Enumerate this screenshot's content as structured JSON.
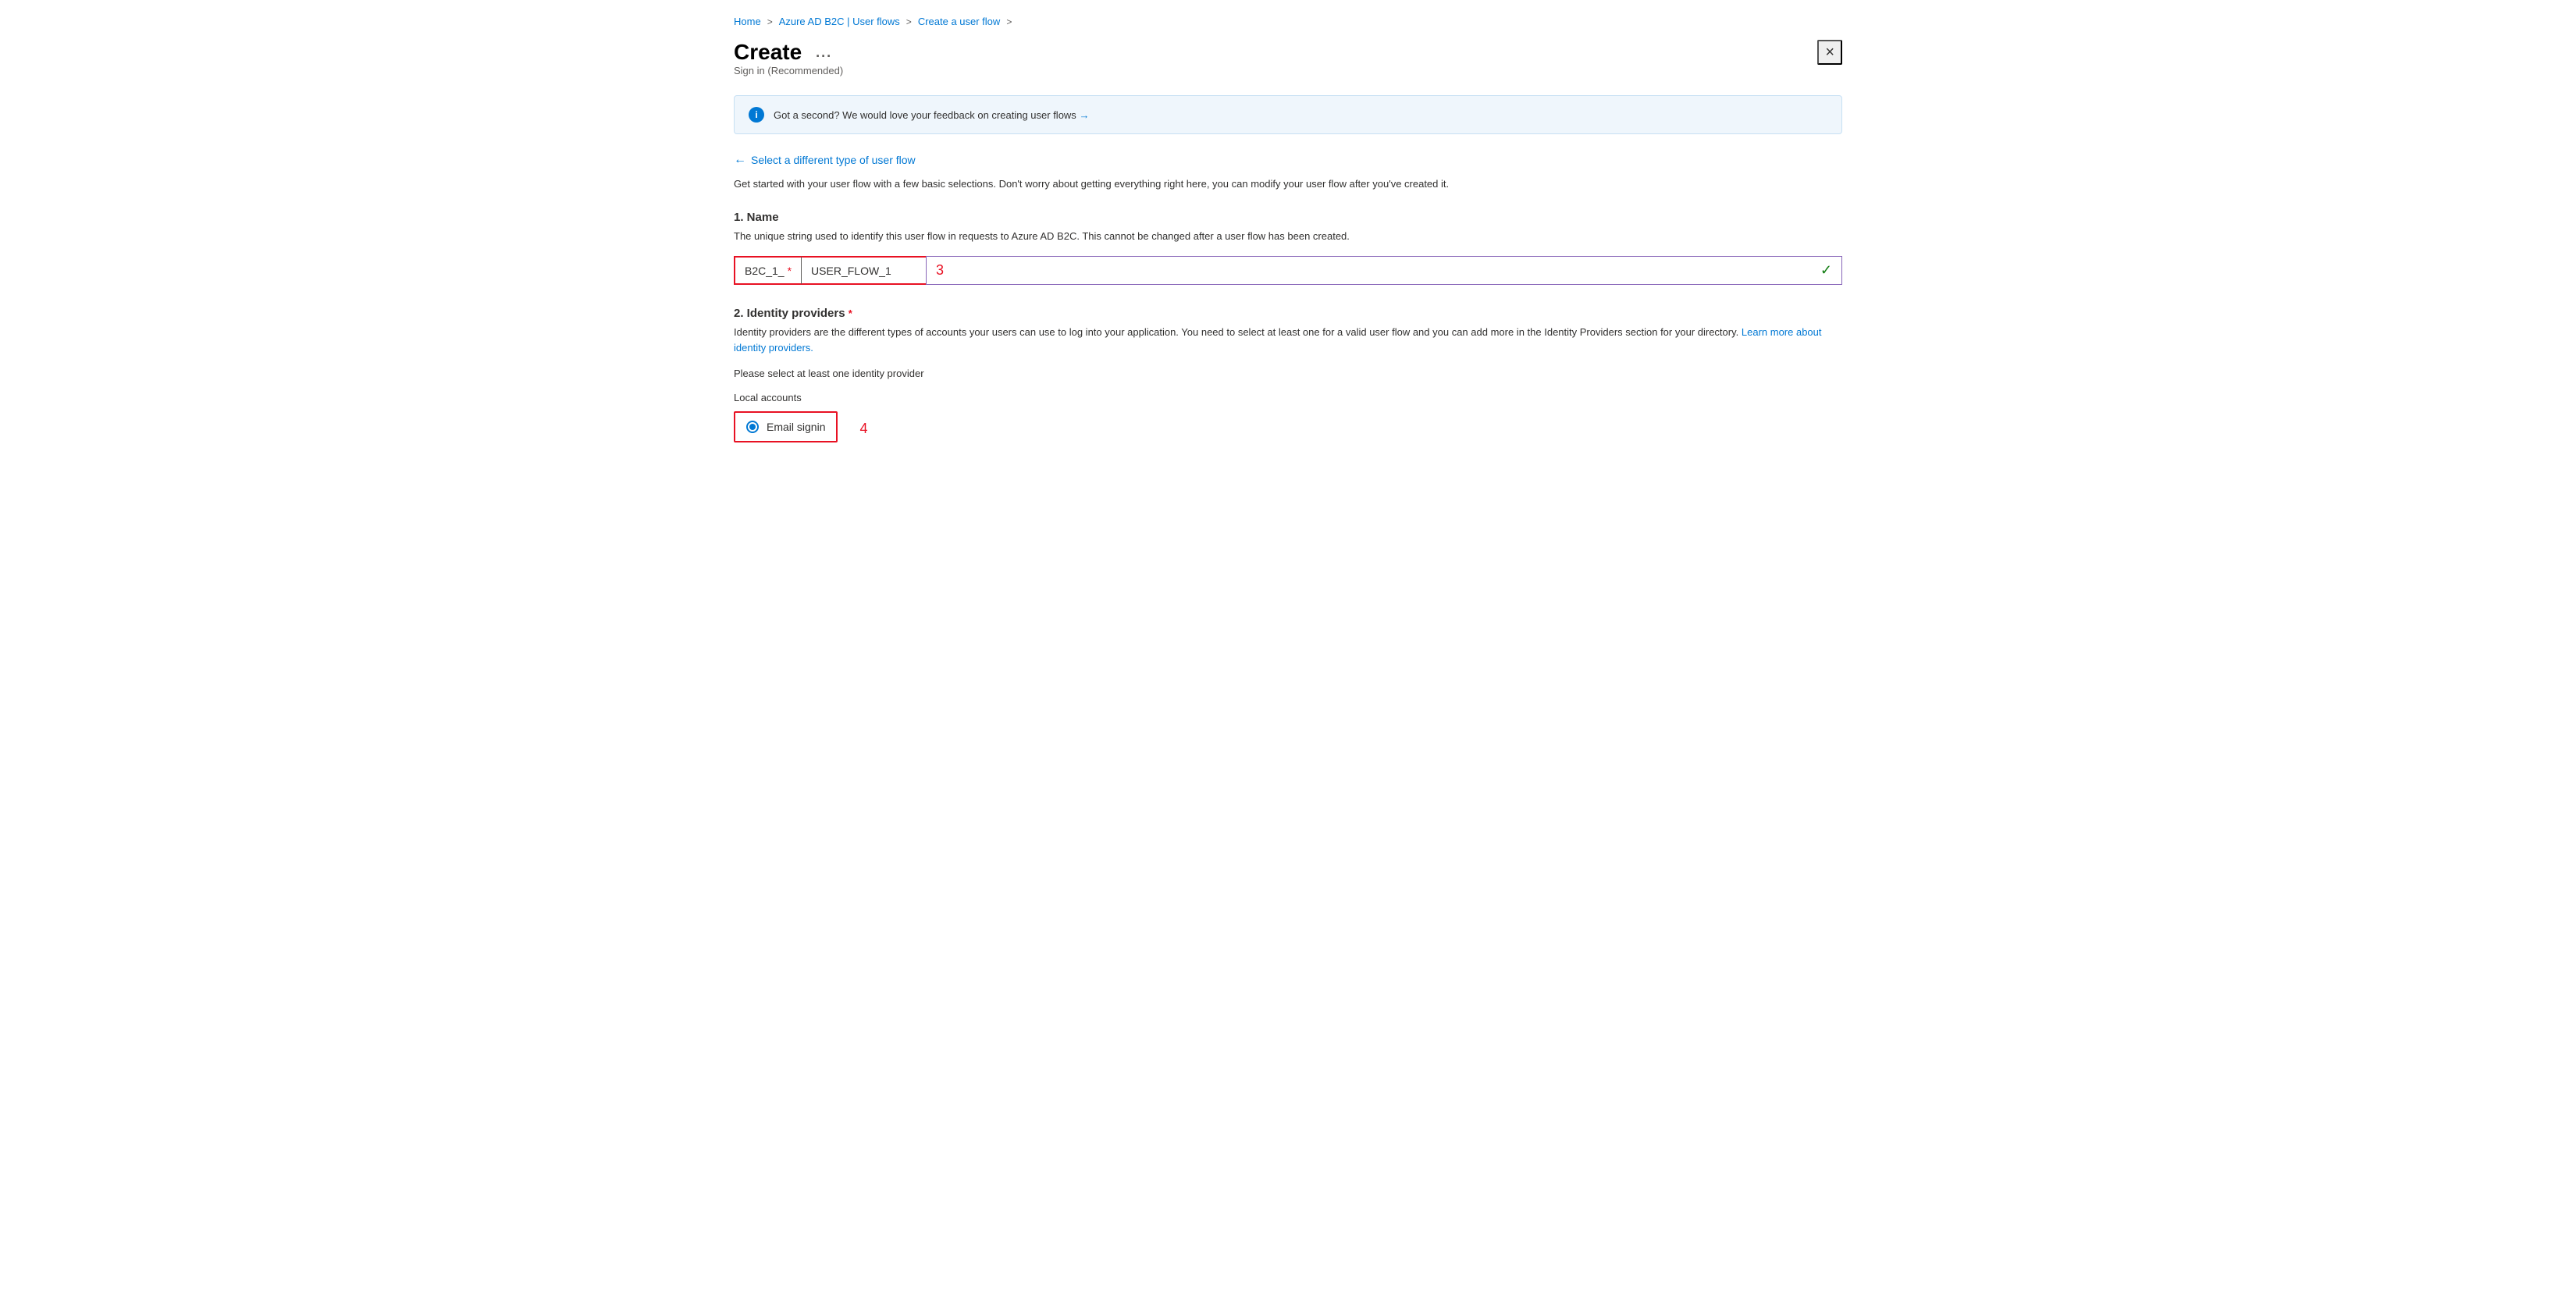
{
  "breadcrumb": {
    "home": "Home",
    "userflows": "Azure AD B2C | User flows",
    "create": "Create a user flow",
    "sep": ">"
  },
  "header": {
    "title": "Create",
    "ellipsis": "...",
    "subtitle": "Sign in (Recommended)",
    "close_label": "×"
  },
  "info_banner": {
    "icon": "i",
    "text": "Got a second? We would love your feedback on creating user flows",
    "arrow": "→"
  },
  "back_link": {
    "arrow": "←",
    "label": "Select a different type of user flow"
  },
  "intro": {
    "text": "Get started with your user flow with a few basic selections. Don't worry about getting everything right here, you can modify your user flow after you've created it."
  },
  "section1": {
    "title": "1. Name",
    "desc": "The unique string used to identify this user flow in requests to Azure AD B2C. This cannot be changed after a user flow has been created.",
    "prefix": "B2C_1_",
    "required_star": "*",
    "input_value": "USER_FLOW_1",
    "annotation": "3",
    "checkmark": "✓"
  },
  "section2": {
    "title": "2. Identity providers",
    "required_star": "*",
    "desc_start": "Identity providers are the different types of accounts your users can use to log into your application. You need to select at least one for a valid user flow and you can add more in the Identity Providers section for your directory.",
    "learn_link_text": "Learn more about identity providers.",
    "select_prompt": "Please select at least one identity provider",
    "local_accounts_label": "Local accounts",
    "radio_option": "Email signin",
    "annotation": "4"
  }
}
